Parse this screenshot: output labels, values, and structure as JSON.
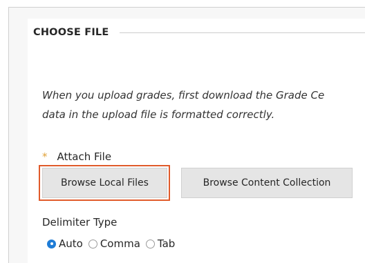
{
  "section": {
    "title": "CHOOSE FILE",
    "instructions_line1": "When you upload grades, first download the Grade Ce",
    "instructions_line2": "data in the upload file is formatted correctly."
  },
  "attach": {
    "required_marker": "*",
    "label": "Attach File",
    "browse_local_label": "Browse Local Files",
    "browse_collection_label": "Browse Content Collection"
  },
  "delimiter": {
    "label": "Delimiter Type",
    "options": [
      "Auto",
      "Comma",
      "Tab"
    ],
    "selected": "Auto"
  },
  "colors": {
    "highlight": "#e05a2a",
    "radio_selected": "#1f7cd6",
    "required_star": "#e0a23a"
  }
}
